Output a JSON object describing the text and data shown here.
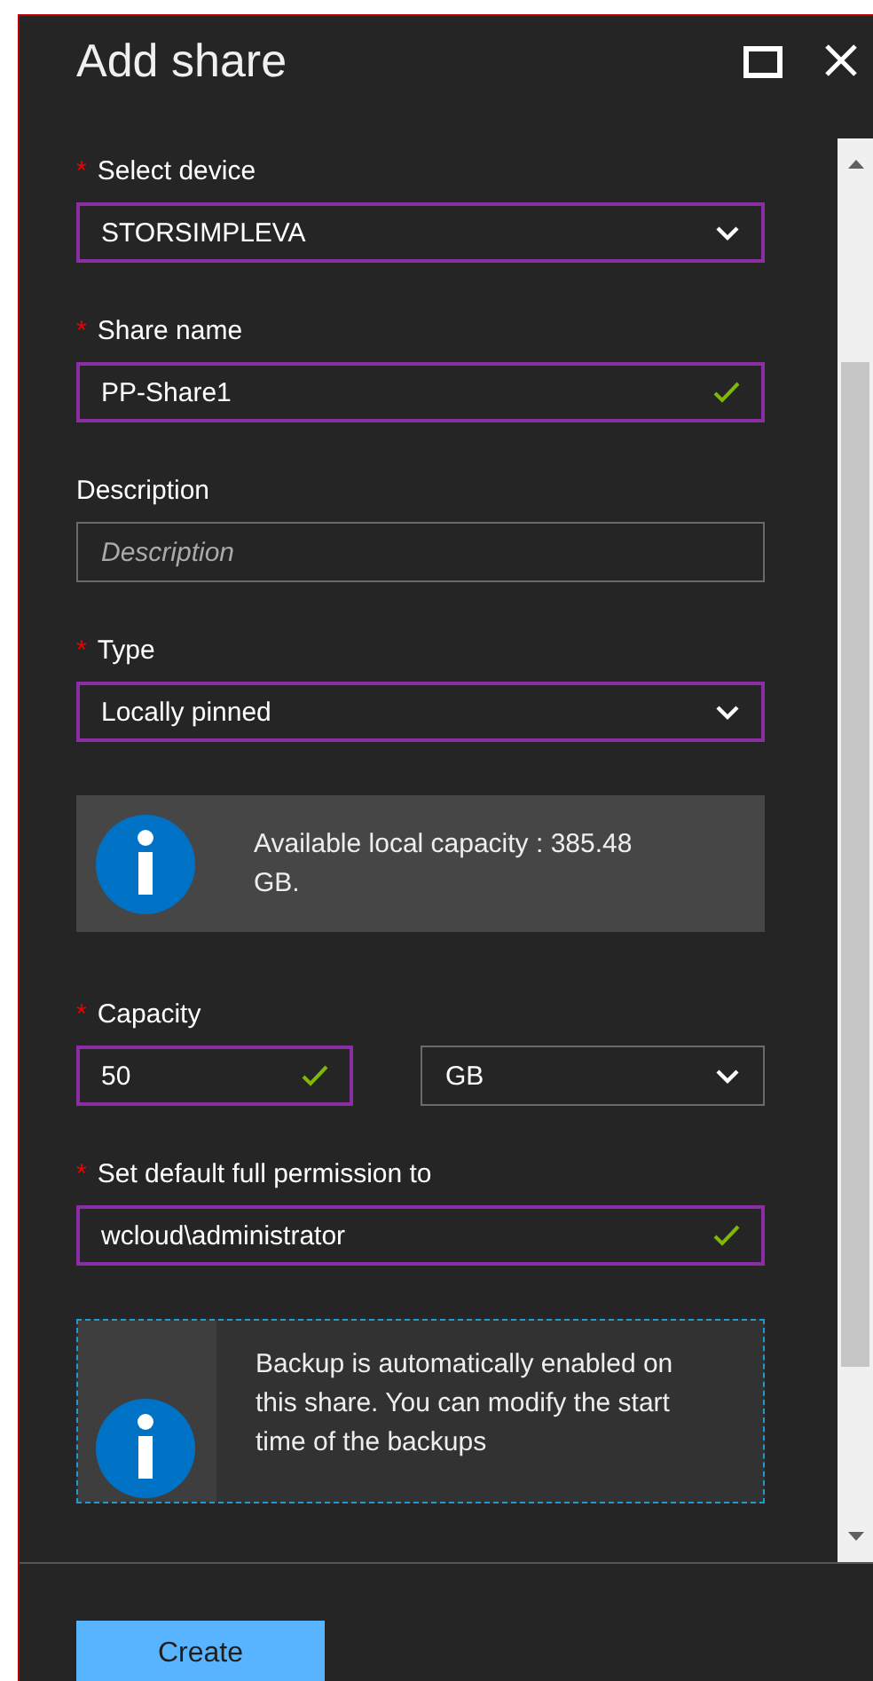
{
  "window": {
    "title": "Add share"
  },
  "fields": [
    {
      "kind": "select",
      "label": "Select device",
      "required_mark": "*",
      "value": "STORSIMPLEVA",
      "highlighted": true
    },
    {
      "kind": "text",
      "label": "Share name",
      "required_mark": "*",
      "value": "PP-Share1",
      "highlighted": true,
      "valid": true
    },
    {
      "kind": "text",
      "label": "Description",
      "placeholder": "Description",
      "highlighted": false,
      "valid": false
    },
    {
      "kind": "select",
      "label": "Type",
      "required_mark": "*",
      "value": "Locally pinned",
      "highlighted": true
    },
    {
      "kind": "info",
      "text": "Available local capacity : 385.48 GB."
    },
    {
      "kind": "pair",
      "label": "Capacity",
      "required_mark": "*",
      "value": "50",
      "highlighted": true,
      "valid": true,
      "unit": "GB"
    },
    {
      "kind": "text",
      "label": "Set default full permission to",
      "required_mark": "*",
      "value": "wcloud\\administrator",
      "highlighted": true,
      "valid": true
    },
    {
      "kind": "note",
      "text": "Backup is automatically enabled on this share. You can modify the start time of the backups"
    }
  ],
  "buttons": [
    {
      "label": "Create"
    }
  ]
}
